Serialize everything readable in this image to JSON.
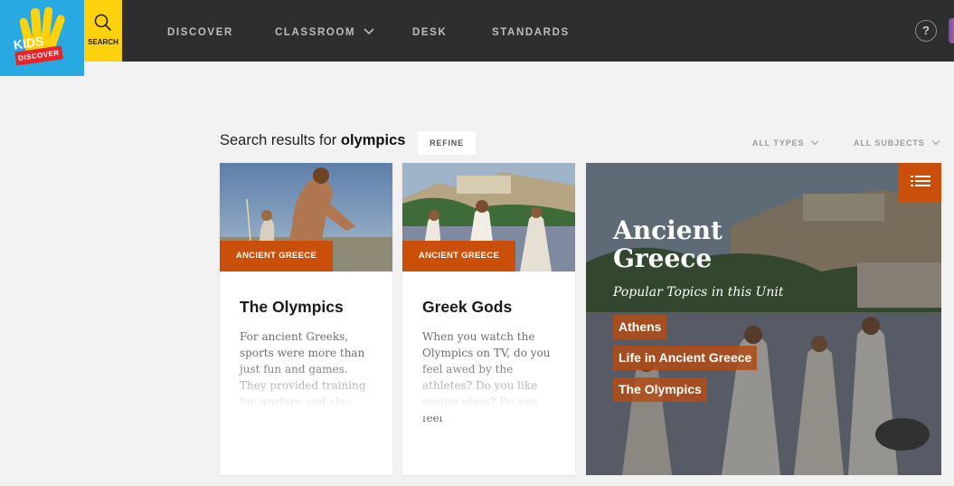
{
  "logo": {
    "line1": "KIDS",
    "line2": "DISCOVER"
  },
  "search": {
    "label": "SEARCH"
  },
  "nav": {
    "discover": "DISCOVER",
    "classroom": "CLASSROOM",
    "desk": "DESK",
    "standards": "STANDARDS"
  },
  "help": {
    "label": "?"
  },
  "results": {
    "prefix": "Search results for ",
    "query": "olympics",
    "refine": "REFINE",
    "filter_types": "ALL TYPES",
    "filter_subjects": "ALL SUBJECTS"
  },
  "cards": [
    {
      "tag": "ANCIENT GREECE",
      "title": "The Olympics",
      "text": "For ancient Greeks, sports were more than just fun and games. They provided training for warfare and also"
    },
    {
      "tag": "ANCIENT GREECE",
      "title": "Greek Gods",
      "text": "When you watch the Olympics on TV, do you feel awed by the athletes? Do you like seeing plays? Do you feel"
    }
  ],
  "unit": {
    "title_line1": "Ancient",
    "title_line2": "Greece",
    "subtitle": "Popular Topics in this Unit",
    "topics": [
      "Athens",
      "Life in Ancient Greece",
      "The Olympics"
    ]
  },
  "colors": {
    "accent": "#c94f0a",
    "topbar": "#2e2e2e",
    "logo_bg": "#29a9e1",
    "search_bg": "#fdd10c"
  }
}
